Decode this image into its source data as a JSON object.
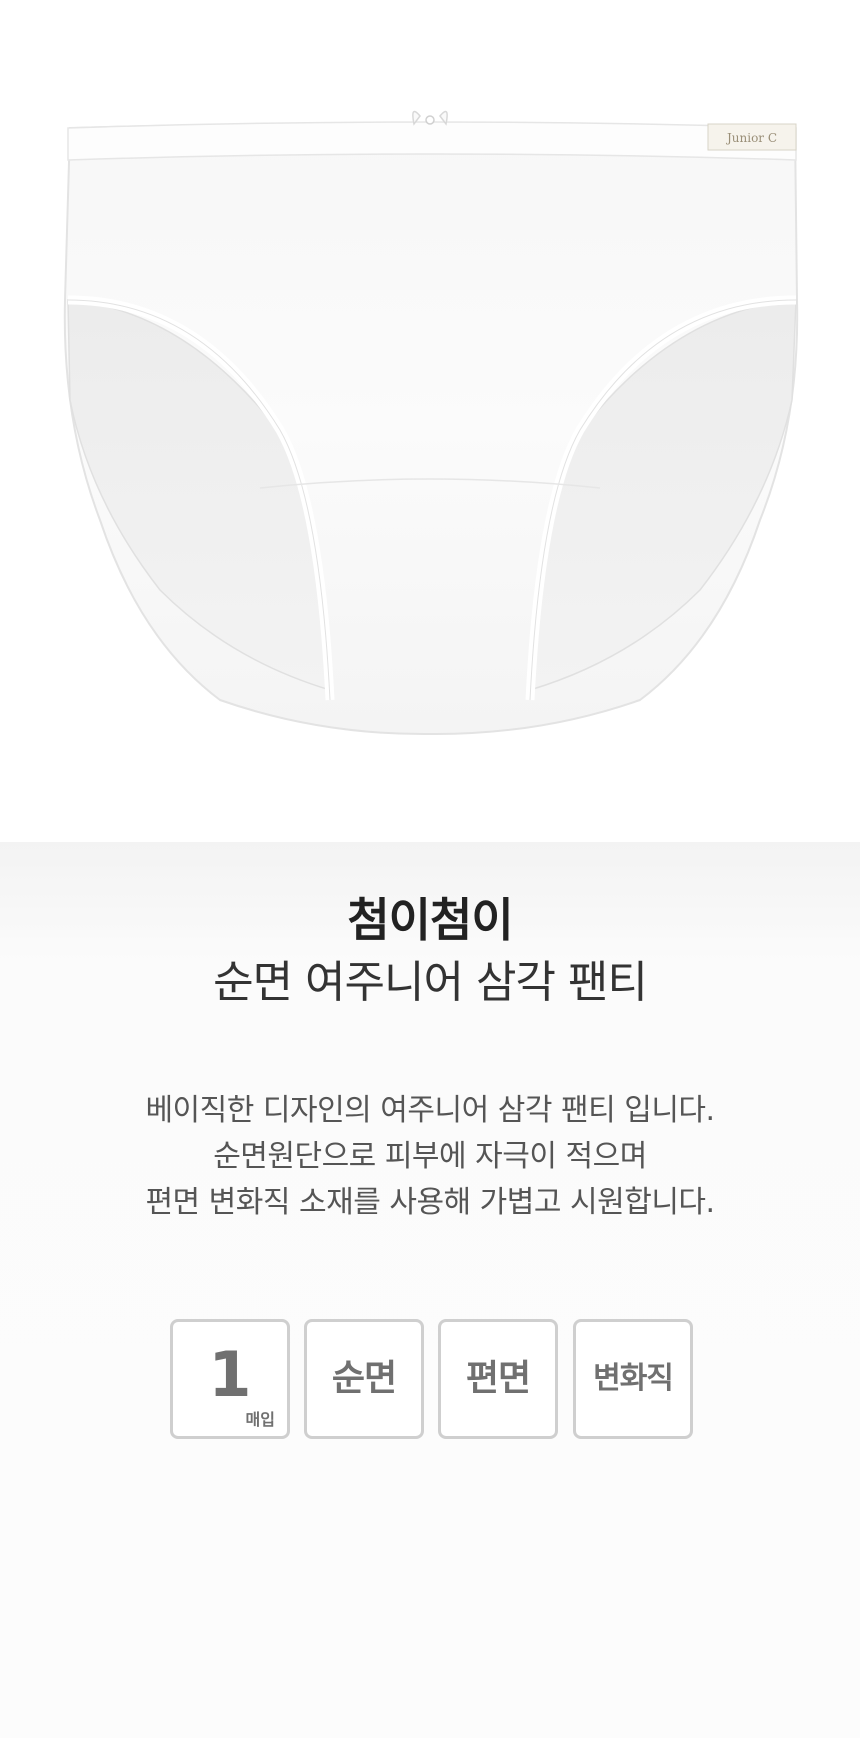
{
  "product_image": {
    "label_tag": "Junior C"
  },
  "title": {
    "brand": "첨이첨이",
    "product": "순면 여주니어 삼각 팬티"
  },
  "description": [
    "베이직한 디자인의 여주니어 삼각 팬티 입니다.",
    "순면원단으로 피부에 자극이 적으며",
    "편면 변화직 소재를 사용해 가볍고 시원합니다."
  ],
  "badges": {
    "quantity": {
      "number": "1",
      "unit": "매입"
    },
    "material": "순면",
    "knit": "편면",
    "weave": "변화직"
  },
  "colors": {
    "badge_border": "#cfcfcf",
    "badge_text": "#707070",
    "info_background": "#f3f3f3"
  }
}
